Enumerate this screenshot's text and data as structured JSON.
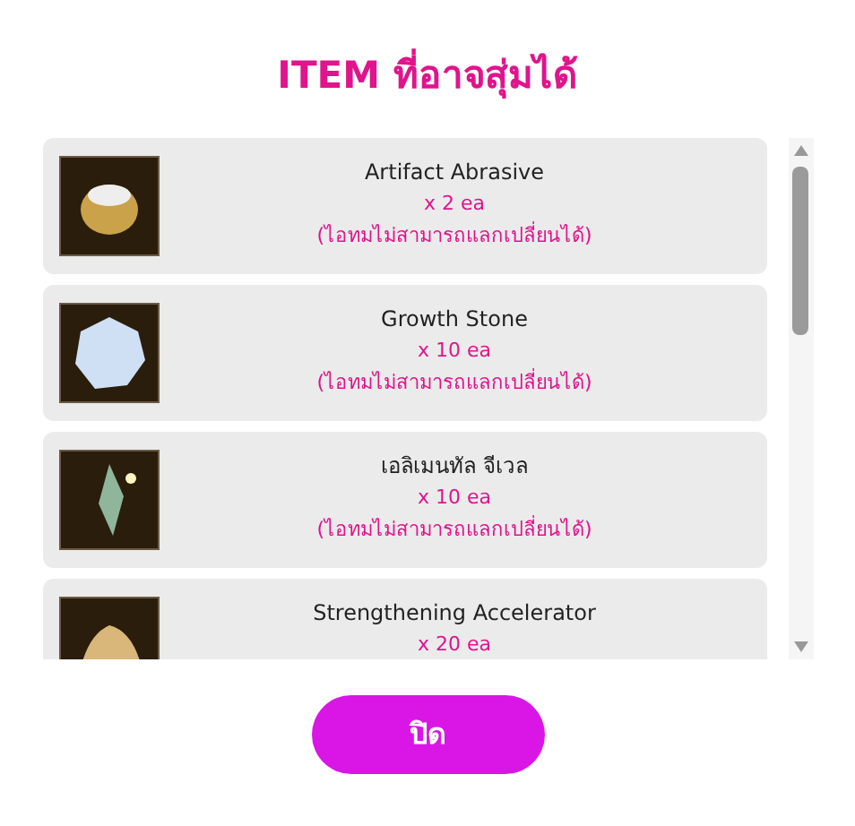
{
  "title": "ITEM ที่อาจสุ่มได้",
  "items": [
    {
      "name": "Artifact Abrasive",
      "quantity": "x 2 ea",
      "note": "(ไอทมไม่สามารถแลกเปลี่ยนได้)",
      "kind": "pouch"
    },
    {
      "name": "Growth Stone",
      "quantity": "x 10 ea",
      "note": "(ไอทมไม่สามารถแลกเปลี่ยนได้)",
      "kind": "stone"
    },
    {
      "name": "เอลิเมนทัล จีเวล",
      "quantity": "x 10 ea",
      "note": "(ไอทมไม่สามารถแลกเปลี่ยนได้)",
      "kind": "jewel"
    },
    {
      "name": "Strengthening Accelerator",
      "quantity": "x 20 ea",
      "kind": "sack"
    }
  ],
  "close_button": "ปิด"
}
